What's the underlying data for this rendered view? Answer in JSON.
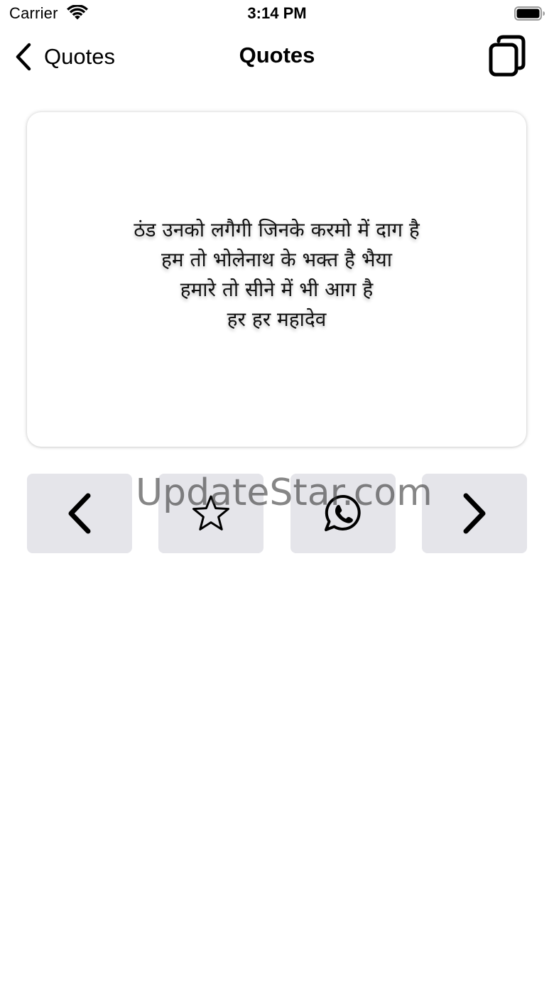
{
  "status_bar": {
    "carrier": "Carrier",
    "time": "3:14 PM",
    "icons": [
      "wifi-icon",
      "battery-icon"
    ]
  },
  "nav": {
    "back_label": "Quotes",
    "title": "Quotes",
    "icons": {
      "back": "chevron-left-icon",
      "copy": "copy-icon"
    }
  },
  "quote": {
    "lines": [
      "ठंड उनको लगैगी जिनके करमो में दाग है",
      "हम तो भोलेनाथ के भक्त है भैया",
      "हमारे तो सीने में भी आग है",
      "हर हर महादेव"
    ]
  },
  "actions": {
    "icons": [
      "chevron-left-icon",
      "star-icon",
      "whatsapp-icon",
      "chevron-right-icon"
    ],
    "button_color": "#e5e5ea"
  },
  "watermark": "UpdateStar.com"
}
